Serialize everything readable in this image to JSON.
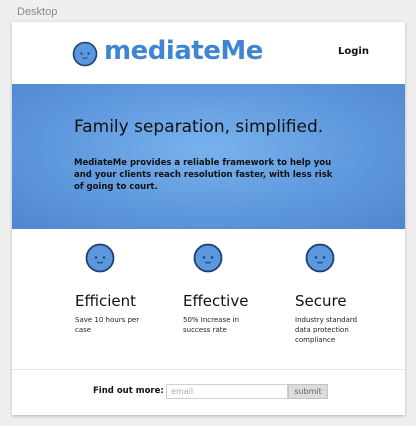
{
  "canvas": {
    "label": "Desktop"
  },
  "header": {
    "logo_text": "mediateMe",
    "login_label": "Login"
  },
  "hero": {
    "title": "Family separation, simplified.",
    "body": "MediateMe provides a reliable framework to help you and your clients reach resolution faster, with less risk of going to court."
  },
  "features": [
    {
      "title": "Efficient",
      "description": "Save 10 hours per case",
      "icon": "smiley-face-icon"
    },
    {
      "title": "Effective",
      "description": "50% Increase in success rate",
      "icon": "smiley-face-icon"
    },
    {
      "title": "Secure",
      "description": "Industry standard data protection compliance",
      "icon": "smiley-face-icon"
    }
  ],
  "signup": {
    "label": "Find out more:",
    "email_placeholder": "email",
    "submit_label": "submit"
  },
  "colors": {
    "brand": "#3f86d2",
    "hero_background": "#6aa5e6",
    "icon_fill": "#5b97dc",
    "icon_stroke": "#1f3f6e"
  }
}
